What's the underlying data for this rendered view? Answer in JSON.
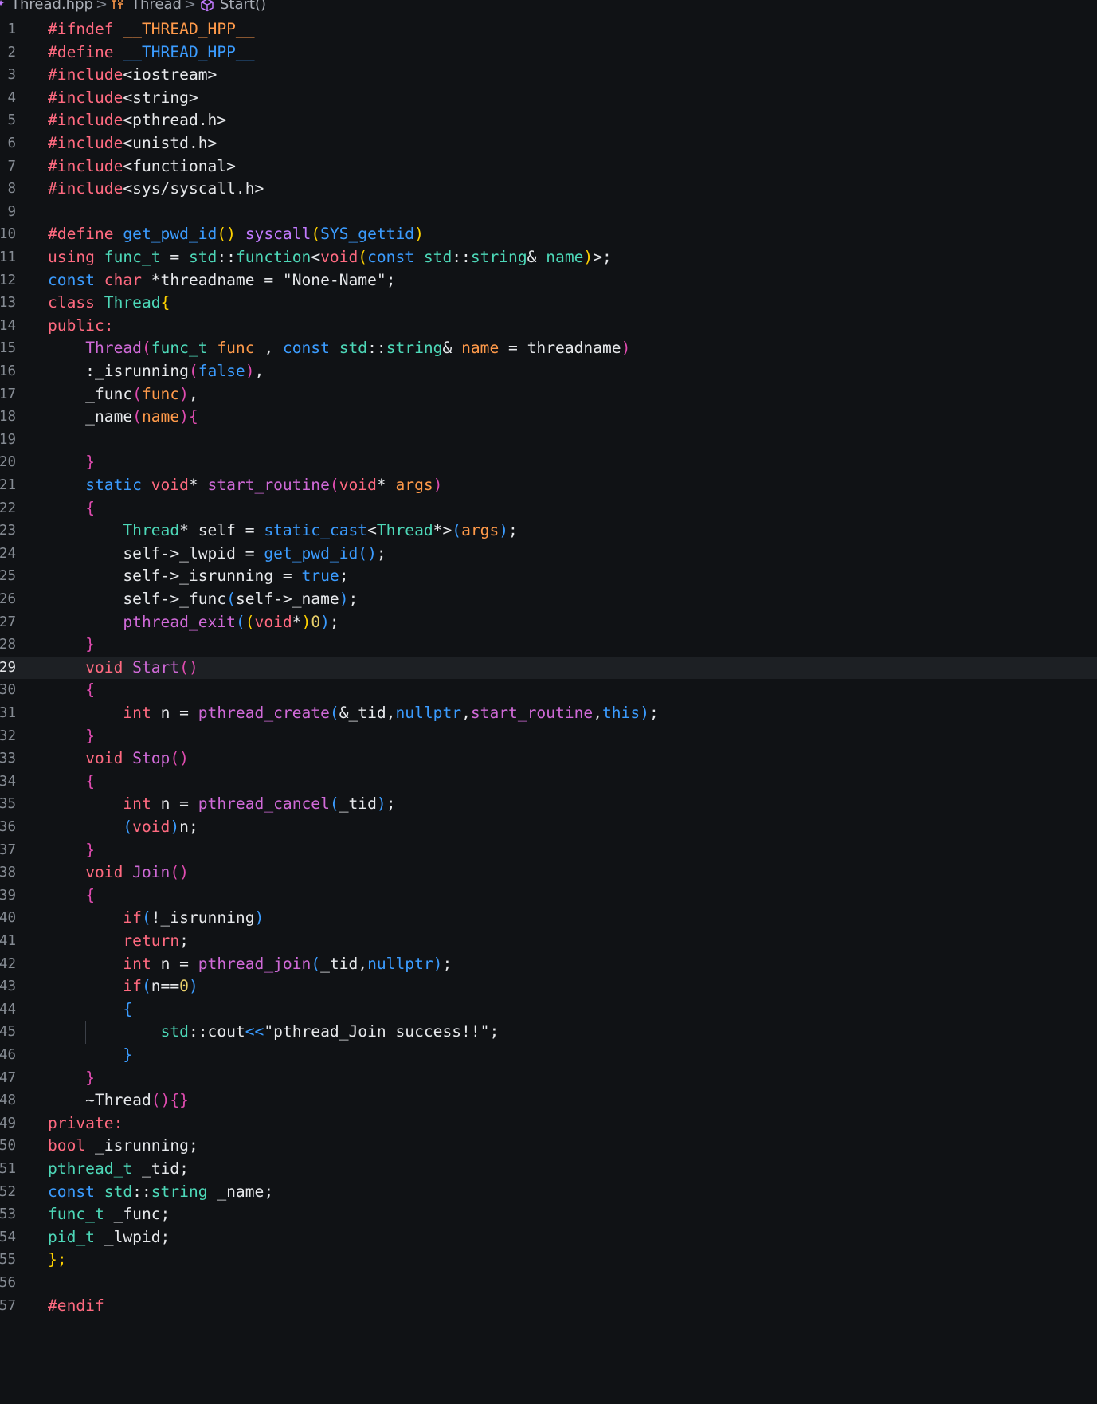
{
  "breadcrumb": {
    "file": "Thread.hpp",
    "class_name": "Thread",
    "method": "Start()",
    "separator": ">"
  },
  "editor": {
    "current_line": 29,
    "lines": [
      [
        [
          "#ifndef ",
          "kw"
        ],
        [
          "__THREAD_HPP__",
          "pr"
        ]
      ],
      [
        [
          "#define ",
          "kw"
        ],
        [
          "__THREAD_HPP__",
          "sb"
        ]
      ],
      [
        [
          "#include",
          "kw"
        ],
        [
          "<iostream>",
          ""
        ]
      ],
      [
        [
          "#include",
          "kw"
        ],
        [
          "<string>",
          ""
        ]
      ],
      [
        [
          "#include",
          "kw"
        ],
        [
          "<pthread.h>",
          ""
        ]
      ],
      [
        [
          "#include",
          "kw"
        ],
        [
          "<unistd.h>",
          ""
        ]
      ],
      [
        [
          "#include",
          "kw"
        ],
        [
          "<functional>",
          ""
        ]
      ],
      [
        [
          "#include",
          "kw"
        ],
        [
          "<sys/syscall.h>",
          ""
        ]
      ],
      [],
      [
        [
          "#define ",
          "kw"
        ],
        [
          "get_pwd_id",
          "sb"
        ],
        [
          "() ",
          "br1"
        ],
        [
          "syscall",
          "fn"
        ],
        [
          "(",
          "br1"
        ],
        [
          "SYS_gettid",
          "sb"
        ],
        [
          ")",
          "br1"
        ]
      ],
      [
        [
          "using ",
          "kw"
        ],
        [
          "func_t",
          "ty"
        ],
        [
          " = ",
          ""
        ],
        [
          "std",
          "ty"
        ],
        [
          "::",
          ""
        ],
        [
          "function",
          "ty"
        ],
        [
          "<",
          ""
        ],
        [
          "void",
          "kw"
        ],
        [
          "(",
          "br1"
        ],
        [
          "const ",
          "sb"
        ],
        [
          "std",
          "ty"
        ],
        [
          "::",
          ""
        ],
        [
          "string",
          "ty"
        ],
        [
          "& ",
          ""
        ],
        [
          "name",
          "ty"
        ],
        [
          ")",
          "br1"
        ],
        [
          ">;",
          ""
        ]
      ],
      [
        [
          "const ",
          "sb"
        ],
        [
          "char ",
          "kw"
        ],
        [
          "*threadname = ",
          ""
        ],
        [
          "\"None-Name\"",
          "str"
        ],
        [
          ";",
          ""
        ]
      ],
      [
        [
          "class ",
          "kw"
        ],
        [
          "Thread",
          "ty"
        ],
        [
          "{",
          "br1"
        ]
      ],
      [
        [
          "public:",
          "kw"
        ]
      ],
      [
        [
          "    ",
          ""
        ],
        [
          "Thread",
          "fn2"
        ],
        [
          "(",
          "br2"
        ],
        [
          "func_t ",
          "ty"
        ],
        [
          "func",
          "pr"
        ],
        [
          " , ",
          ""
        ],
        [
          "const ",
          "sb"
        ],
        [
          "std",
          "ty"
        ],
        [
          "::",
          ""
        ],
        [
          "string",
          "ty"
        ],
        [
          "& ",
          ""
        ],
        [
          "name",
          "pr"
        ],
        [
          " = threadname",
          ""
        ],
        [
          ")",
          "br2"
        ]
      ],
      [
        [
          "    :_isrunning",
          ""
        ],
        [
          "(",
          "br2"
        ],
        [
          "false",
          "sb"
        ],
        [
          ")",
          "br2"
        ],
        [
          ",",
          ""
        ]
      ],
      [
        [
          "    _func",
          ""
        ],
        [
          "(",
          "br2"
        ],
        [
          "func",
          "pr"
        ],
        [
          ")",
          "br2"
        ],
        [
          ",",
          ""
        ]
      ],
      [
        [
          "    _name",
          ""
        ],
        [
          "(",
          "br2"
        ],
        [
          "name",
          "pr"
        ],
        [
          ")",
          "br2"
        ],
        [
          "{",
          "br2"
        ]
      ],
      [],
      [
        [
          "    ",
          ""
        ],
        [
          "}",
          "br2"
        ]
      ],
      [
        [
          "    ",
          ""
        ],
        [
          "static ",
          "sb"
        ],
        [
          "void",
          "kw"
        ],
        [
          "* ",
          ""
        ],
        [
          "start_routine",
          "fn2"
        ],
        [
          "(",
          "br2"
        ],
        [
          "void",
          "kw"
        ],
        [
          "* ",
          ""
        ],
        [
          "args",
          "pr"
        ],
        [
          ")",
          "br2"
        ]
      ],
      [
        [
          "    ",
          ""
        ],
        [
          "{",
          "br2"
        ]
      ],
      [
        [
          "        ",
          ""
        ],
        [
          "Thread",
          "ty"
        ],
        [
          "* self = ",
          ""
        ],
        [
          "static_cast",
          "sb"
        ],
        [
          "<",
          ""
        ],
        [
          "Thread",
          "ty"
        ],
        [
          "*>",
          ""
        ],
        [
          "(",
          "br3"
        ],
        [
          "args",
          "pr"
        ],
        [
          ")",
          "br3"
        ],
        [
          ";",
          ""
        ]
      ],
      [
        [
          "        self->_lwpid = ",
          ""
        ],
        [
          "get_pwd_id",
          "sb"
        ],
        [
          "()",
          "br3"
        ],
        [
          ";",
          ""
        ]
      ],
      [
        [
          "        self->_isrunning = ",
          ""
        ],
        [
          "true",
          "sb"
        ],
        [
          ";",
          ""
        ]
      ],
      [
        [
          "        self->_func",
          ""
        ],
        [
          "(",
          "br3"
        ],
        [
          "self->_name",
          ""
        ],
        [
          ")",
          "br3"
        ],
        [
          ";",
          ""
        ]
      ],
      [
        [
          "        ",
          ""
        ],
        [
          "pthread_exit",
          "fn2"
        ],
        [
          "(",
          "br3"
        ],
        [
          "(",
          "br1"
        ],
        [
          "void",
          "kw"
        ],
        [
          "*",
          ""
        ],
        [
          ")",
          "br1"
        ],
        [
          "0",
          "num"
        ],
        [
          ")",
          "br3"
        ],
        [
          ";",
          ""
        ]
      ],
      [
        [
          "    ",
          ""
        ],
        [
          "}",
          "br2"
        ]
      ],
      [
        [
          "    ",
          ""
        ],
        [
          "void ",
          "kw"
        ],
        [
          "Start",
          "fn2"
        ],
        [
          "()",
          "br2"
        ]
      ],
      [
        [
          "    ",
          ""
        ],
        [
          "{",
          "br2"
        ]
      ],
      [
        [
          "        ",
          ""
        ],
        [
          "int ",
          "kw"
        ],
        [
          "n = ",
          ""
        ],
        [
          "pthread_create",
          "fn2"
        ],
        [
          "(",
          "br3"
        ],
        [
          "&_tid,",
          ""
        ],
        [
          "nullptr",
          "sb"
        ],
        [
          ",",
          ""
        ],
        [
          "start_routine",
          "fn2"
        ],
        [
          ",",
          ""
        ],
        [
          "this",
          "sb"
        ],
        [
          ")",
          "br3"
        ],
        [
          ";",
          ""
        ]
      ],
      [
        [
          "    ",
          ""
        ],
        [
          "}",
          "br2"
        ]
      ],
      [
        [
          "    ",
          ""
        ],
        [
          "void ",
          "kw"
        ],
        [
          "Stop",
          "fn2"
        ],
        [
          "()",
          "br2"
        ]
      ],
      [
        [
          "    ",
          ""
        ],
        [
          "{",
          "br2"
        ]
      ],
      [
        [
          "        ",
          ""
        ],
        [
          "int ",
          "kw"
        ],
        [
          "n = ",
          ""
        ],
        [
          "pthread_cancel",
          "fn2"
        ],
        [
          "(",
          "br3"
        ],
        [
          "_tid",
          ""
        ],
        [
          ")",
          "br3"
        ],
        [
          ";",
          ""
        ]
      ],
      [
        [
          "        ",
          ""
        ],
        [
          "(",
          "br3"
        ],
        [
          "void",
          "kw"
        ],
        [
          ")",
          "br3"
        ],
        [
          "n;",
          ""
        ]
      ],
      [
        [
          "    ",
          ""
        ],
        [
          "}",
          "br2"
        ]
      ],
      [
        [
          "    ",
          ""
        ],
        [
          "void ",
          "kw"
        ],
        [
          "Join",
          "fn2"
        ],
        [
          "()",
          "br2"
        ]
      ],
      [
        [
          "    ",
          ""
        ],
        [
          "{",
          "br2"
        ]
      ],
      [
        [
          "        ",
          ""
        ],
        [
          "if",
          "kw"
        ],
        [
          "(",
          "br3"
        ],
        [
          "!_isrunning",
          ""
        ],
        [
          ")",
          "br3"
        ]
      ],
      [
        [
          "        ",
          ""
        ],
        [
          "return",
          "kw"
        ],
        [
          ";",
          ""
        ]
      ],
      [
        [
          "        ",
          ""
        ],
        [
          "int ",
          "kw"
        ],
        [
          "n = ",
          ""
        ],
        [
          "pthread_join",
          "fn2"
        ],
        [
          "(",
          "br3"
        ],
        [
          "_tid,",
          ""
        ],
        [
          "nullptr",
          "sb"
        ],
        [
          ")",
          "br3"
        ],
        [
          ";",
          ""
        ]
      ],
      [
        [
          "        ",
          ""
        ],
        [
          "if",
          "kw"
        ],
        [
          "(",
          "br3"
        ],
        [
          "n==",
          ""
        ],
        [
          "0",
          "num"
        ],
        [
          ")",
          "br3"
        ]
      ],
      [
        [
          "        ",
          ""
        ],
        [
          "{",
          "br3"
        ]
      ],
      [
        [
          "            ",
          ""
        ],
        [
          "std",
          "ty"
        ],
        [
          "::",
          ""
        ],
        [
          "cout",
          ""
        ],
        [
          "<<",
          "sb"
        ],
        [
          "\"pthread_Join success!!\"",
          "str"
        ],
        [
          ";",
          ""
        ]
      ],
      [
        [
          "        ",
          ""
        ],
        [
          "}",
          "br3"
        ]
      ],
      [
        [
          "    ",
          ""
        ],
        [
          "}",
          "br2"
        ]
      ],
      [
        [
          "    ~Thread",
          ""
        ],
        [
          "()",
          "br2"
        ],
        [
          "{}",
          "br2"
        ]
      ],
      [
        [
          "private:",
          "kw"
        ]
      ],
      [
        [
          "bool ",
          "kw"
        ],
        [
          "_isrunning;",
          ""
        ]
      ],
      [
        [
          "pthread_t ",
          "ty"
        ],
        [
          "_tid;",
          ""
        ]
      ],
      [
        [
          "const ",
          "sb"
        ],
        [
          "std",
          "ty"
        ],
        [
          "::",
          ""
        ],
        [
          "string ",
          "ty"
        ],
        [
          "_name;",
          ""
        ]
      ],
      [
        [
          "func_t ",
          "ty"
        ],
        [
          "_func;",
          ""
        ]
      ],
      [
        [
          "pid_t ",
          "ty"
        ],
        [
          "_lwpid;",
          ""
        ]
      ],
      [
        [
          "};",
          "br1"
        ]
      ],
      [],
      [
        [
          "#endif",
          "kw"
        ]
      ]
    ]
  }
}
